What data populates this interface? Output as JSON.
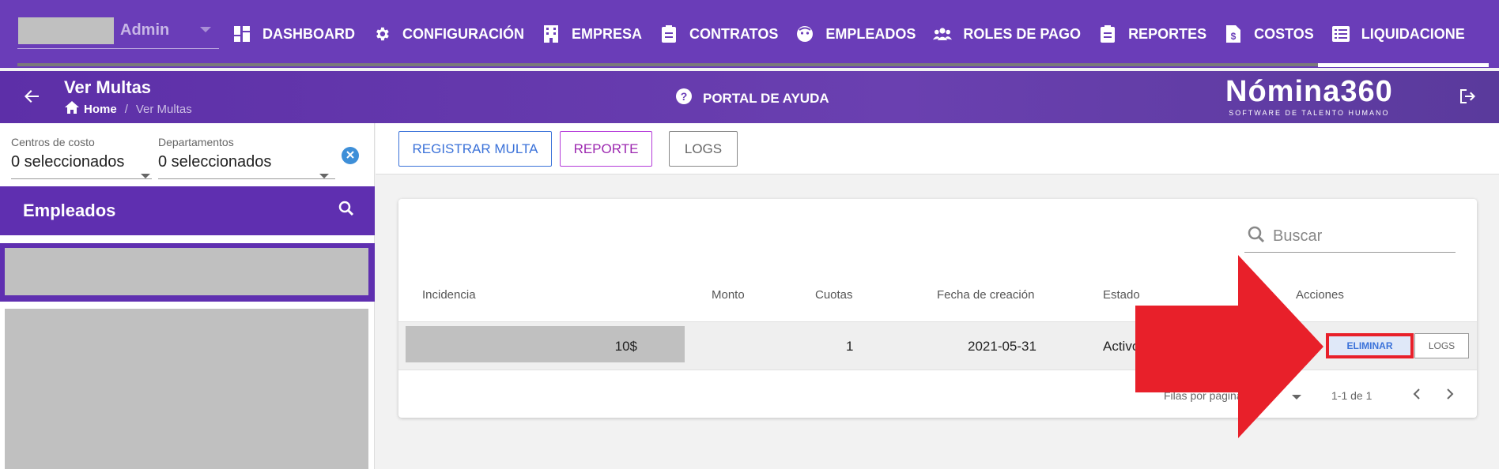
{
  "account": {
    "name": "Admin"
  },
  "nav": [
    {
      "label": "DASHBOARD",
      "icon": "dashboard-icon"
    },
    {
      "label": "CONFIGURACIÓN",
      "icon": "gear-icon"
    },
    {
      "label": "EMPRESA",
      "icon": "building-icon"
    },
    {
      "label": "CONTRATOS",
      "icon": "clipboard-icon"
    },
    {
      "label": "EMPLEADOS",
      "icon": "face-icon"
    },
    {
      "label": "ROLES DE PAGO",
      "icon": "group-icon"
    },
    {
      "label": "REPORTES",
      "icon": "clipboard-icon"
    },
    {
      "label": "COSTOS",
      "icon": "dollar-file-icon"
    },
    {
      "label": "LIQUIDACIONE",
      "icon": "list-icon"
    }
  ],
  "subheader": {
    "title": "Ver Multas",
    "breadcrumb_home": "Home",
    "breadcrumb_sep": "/",
    "breadcrumb_current": "Ver Multas",
    "help_label": "PORTAL DE AYUDA",
    "brand_name": "Nómina360",
    "brand_tagline": "SOFTWARE DE TALENTO HUMANO"
  },
  "filters": {
    "centros_label": "Centros de costo",
    "centros_value": "0 seleccionados",
    "departamentos_label": "Departamentos",
    "departamentos_value": "0 seleccionados"
  },
  "employees": {
    "title": "Empleados"
  },
  "toolbar": {
    "register_label": "REGISTRAR MULTA",
    "report_label": "REPORTE",
    "logs_label": "LOGS"
  },
  "table": {
    "search_placeholder": "Buscar",
    "headers": {
      "incidencia": "Incidencia",
      "monto": "Monto",
      "cuotas": "Cuotas",
      "fecha": "Fecha de creación",
      "estado": "Estado",
      "acciones": "Acciones"
    },
    "rows": [
      {
        "monto": "10$",
        "cuotas": "1",
        "fecha": "2021-05-31",
        "estado": "Activo"
      }
    ],
    "actions": {
      "eliminar": "ELIMINAR",
      "logs": "LOGS"
    },
    "pagination": {
      "rows_per_page_label": "Filas por pagina",
      "range": "1-1 de 1"
    }
  },
  "colors": {
    "primary_purple": "#6a3db8",
    "accent_blue": "#3b72d9",
    "report_purple": "#9c27b0",
    "highlight_red": "#e8202a"
  }
}
